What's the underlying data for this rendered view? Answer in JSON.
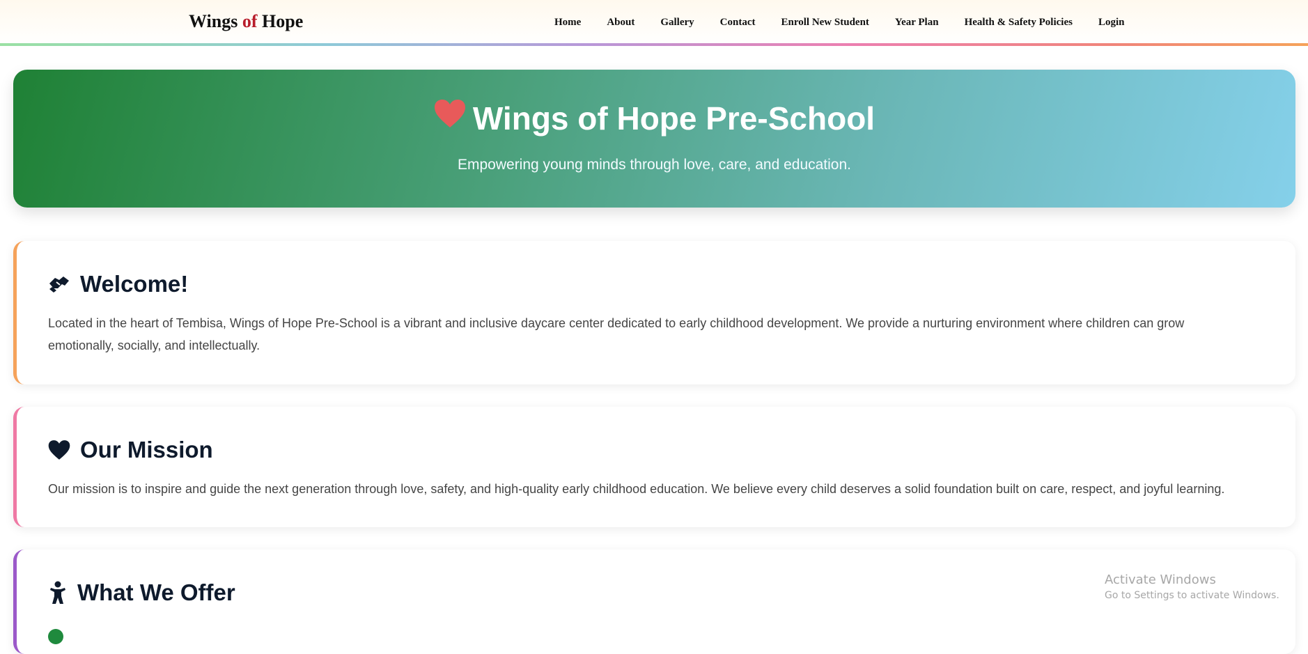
{
  "nav": {
    "brand_part1": "Wings ",
    "brand_of": "of",
    "brand_part2": " Hope",
    "links": [
      "Home",
      "About",
      "Gallery",
      "Contact",
      "Enroll New Student",
      "Year Plan",
      "Health & Safety Policies",
      "Login"
    ]
  },
  "hero": {
    "title": "Wings of Hope Pre-School",
    "subtitle": "Empowering young minds through love, care, and education.",
    "heart_color": "#e85a5a"
  },
  "welcome": {
    "heading": "Welcome!",
    "icon": "handshake-icon",
    "text": "Located in the heart of Tembisa, Wings of Hope Pre-School is a vibrant and inclusive daycare center dedicated to early childhood development. We provide a nurturing environment where children can grow emotionally, socially, and intellectually."
  },
  "mission": {
    "heading": "Our Mission",
    "icon": "heart-icon",
    "text": "Our mission is to inspire and guide the next generation through love, safety, and high-quality early childhood education. We believe every child deserves a solid foundation built on care, respect, and joyful learning."
  },
  "offer": {
    "heading": "What We Offer",
    "icon": "child-icon"
  },
  "watermark": {
    "line1": "Activate Windows",
    "line2": "Go to Settings to activate Windows."
  },
  "colors": {
    "hero_start": "#1f8135",
    "hero_end": "#85d0ea",
    "welcome_accent": "#f5a25a",
    "mission_accent": "#ef79a4",
    "offer_accent": "#9b59c9",
    "brand_of": "#b81d2b"
  }
}
